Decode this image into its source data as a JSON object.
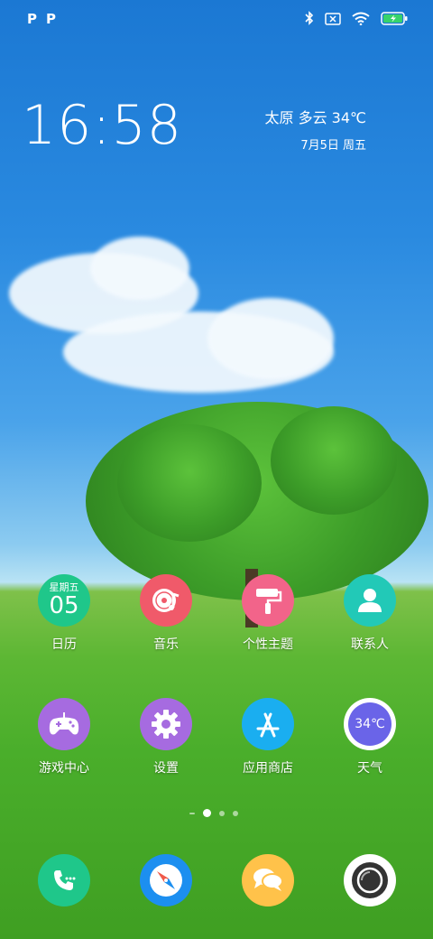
{
  "status_bar": {
    "left_icons": [
      "P",
      "P"
    ],
    "right_icons": [
      "bluetooth-icon",
      "sim-off-icon",
      "wifi-icon",
      "battery-charging-icon"
    ]
  },
  "clock": {
    "time": "16:58"
  },
  "weather_widget": {
    "city_weather": "太原 多云 34℃",
    "date": "7月5日 周五"
  },
  "apps_row1": [
    {
      "label": "日历",
      "weekday": "星期五",
      "day": "05",
      "color": "#1fc78a"
    },
    {
      "label": "音乐",
      "color": "#f05a6a"
    },
    {
      "label": "个性主题",
      "color": "#f2648a"
    },
    {
      "label": "联系人",
      "color": "#22c9b7"
    }
  ],
  "apps_row2": [
    {
      "label": "游戏中心",
      "color": "#a66be0"
    },
    {
      "label": "设置",
      "color": "#a66be0"
    },
    {
      "label": "应用商店",
      "color": "#1aaef0"
    },
    {
      "label": "天气",
      "temp": "34℃",
      "color": "#6a64e8"
    }
  ],
  "page_indicator": {
    "pages": 4,
    "active": 1
  },
  "dock": [
    {
      "name": "phone",
      "color": "#1fc78a"
    },
    {
      "name": "browser",
      "color": "#1c8ff0"
    },
    {
      "name": "messages",
      "color": "#ffc24a"
    },
    {
      "name": "camera",
      "color": "#ffffff"
    }
  ]
}
